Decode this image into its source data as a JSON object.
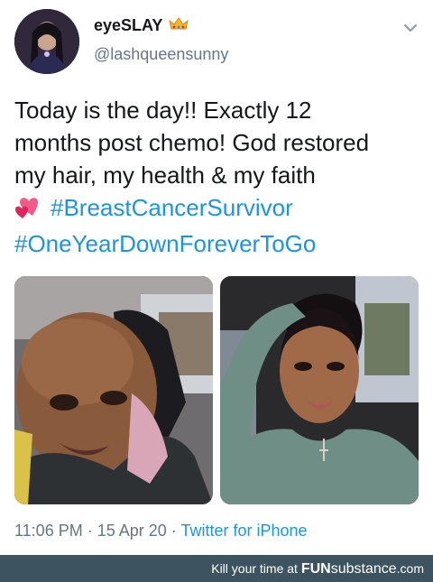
{
  "author": {
    "display_name": "eyeSLAY",
    "handle": "@lashqueensunny"
  },
  "tweet": {
    "line1": "Today is the day!! Exactly 12",
    "line2": "months post chemo! God restored",
    "line3": "my hair, my health & my faith",
    "hashtag1": "#BreastCancerSurvivor",
    "hashtag2": "#OneYearDownForeverToGo"
  },
  "meta": {
    "time": "11:06 PM",
    "date": "15 Apr 20",
    "source": "Twitter for iPhone"
  },
  "footer": {
    "tagline": "Kill your time at",
    "brand_bold": "FUN",
    "brand_thin": "substance",
    "brand_suffix": ".com"
  },
  "colors": {
    "link": "#1b95e0",
    "secondary_text": "#657786",
    "footer_bg": "#3e5360"
  },
  "icons": {
    "crown": "crown-emoji",
    "hearts": "two-hearts-emoji",
    "chevron": "chevron-down"
  }
}
